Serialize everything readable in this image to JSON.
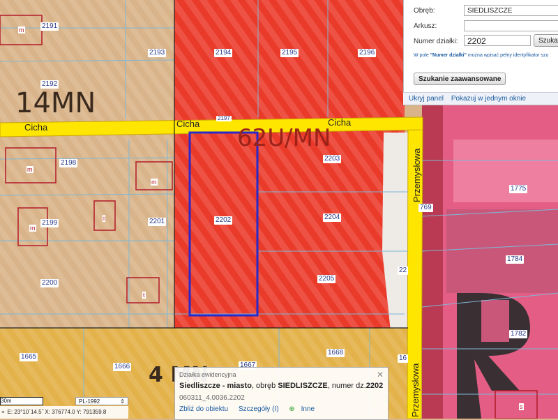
{
  "map": {
    "streets": [
      "Cicha",
      "Cicha",
      "Cicha",
      "Przemysłowa",
      "Przemysłowa"
    ],
    "zones": [
      "14MN",
      "4 MN",
      "62U/MN"
    ],
    "parcels": [
      "2191",
      "2192",
      "2193",
      "2194",
      "2195",
      "2196",
      "2198",
      "2199",
      "2200",
      "2201",
      "2202",
      "2203",
      "2204",
      "2205",
      "1665",
      "1666",
      "1667",
      "1668",
      "1775",
      "1782",
      "1784",
      "769",
      "22",
      "16",
      "2197"
    ],
    "building_marks": [
      "m",
      "m",
      "m",
      "m",
      "i",
      "t",
      "s"
    ],
    "colors": {
      "red_zone": "#ea3a2a",
      "tan_zone": "#d9b48a",
      "orange_zone": "#e3b24a",
      "street_yellow": "#ffe600",
      "selected_outline": "#2a28c9",
      "parcel_line": "#7fb7d6",
      "building_line": "#b21a2a"
    }
  },
  "search": {
    "obreb_label": "Obręb:",
    "obreb_value": "SIEDLISZCZE",
    "arkusz_label": "Arkusz:",
    "arkusz_value": "",
    "numer_label": "Numer działki:",
    "numer_value": "2202",
    "search_button": "Szuka",
    "hint_prefix": "W pole ",
    "hint_bold": "\"Numer działki\"",
    "hint_suffix": " można wpisać pełny identyfikator szu",
    "advanced_button": "Szukanie zaawansowane",
    "hide_panel": "Ukryj panel",
    "show_in_window": "Pokazuj w jednym oknie"
  },
  "popup": {
    "caption": "Działka ewidencyjna",
    "title_bold": "Siedliszcze - miasto",
    "title_mid": ", obręb ",
    "obreb_bold": "SIEDLISZCZE",
    "title_mid2": ", numer dz.",
    "number_bold": "2202",
    "identifier": "060311_4.0036.2202",
    "zoom_link": "Zbliż do obiektu",
    "details_link": "Szczegóły (I)",
    "other_link": "Inne",
    "close": "✕"
  },
  "status": {
    "scale": "30m",
    "projection": "PL-1992",
    "coords": "E: 23°10´14.5˝  X: 376774.0  Y: 791359.8"
  }
}
